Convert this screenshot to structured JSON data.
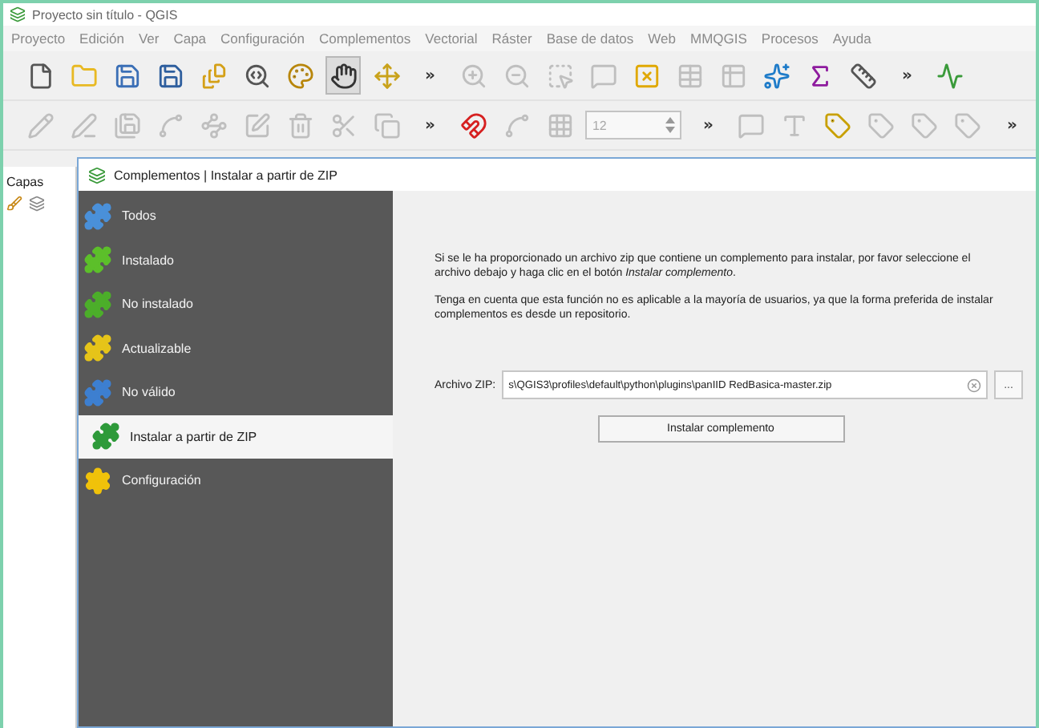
{
  "window": {
    "title": "Proyecto sin título - QGIS"
  },
  "menu": [
    "Proyecto",
    "Edición",
    "Ver",
    "Capa",
    "Configuración",
    "Complementos",
    "Vectorial",
    "Ráster",
    "Base de datos",
    "Web",
    "MMQGIS",
    "Procesos",
    "Ayuda"
  ],
  "toolbar_1": [
    {
      "kind": "icon",
      "disabled": false,
      "selected": false
    },
    {
      "kind": "icon",
      "disabled": false,
      "selected": false
    },
    {
      "kind": "icon",
      "disabled": false,
      "selected": false
    },
    {
      "kind": "icon",
      "disabled": false,
      "selected": false
    },
    {
      "kind": "icon",
      "disabled": false,
      "selected": false
    },
    {
      "kind": "icon",
      "disabled": false,
      "selected": false
    },
    {
      "kind": "icon",
      "disabled": false,
      "selected": false
    },
    {
      "kind": "icon",
      "disabled": false,
      "selected": true
    },
    {
      "kind": "icon",
      "disabled": false,
      "selected": false
    },
    {
      "kind": "overflow",
      "text": "»"
    },
    {
      "kind": "icon",
      "disabled": true,
      "selected": false
    },
    {
      "kind": "icon",
      "disabled": true,
      "selected": false
    },
    {
      "kind": "icon",
      "disabled": true,
      "selected": false
    },
    {
      "kind": "icon",
      "disabled": true,
      "selected": false
    },
    {
      "kind": "icon",
      "disabled": false,
      "selected": false
    },
    {
      "kind": "icon",
      "disabled": true,
      "selected": false
    },
    {
      "kind": "icon",
      "disabled": true,
      "selected": false
    },
    {
      "kind": "icon",
      "disabled": false,
      "selected": false
    },
    {
      "kind": "icon",
      "disabled": false,
      "selected": false
    },
    {
      "kind": "icon",
      "disabled": false,
      "selected": false
    },
    {
      "kind": "overflow",
      "text": "»"
    },
    {
      "kind": "icon",
      "disabled": false,
      "selected": false
    }
  ],
  "toolbar_2": [
    {
      "kind": "icon",
      "disabled": true,
      "selected": false
    },
    {
      "kind": "icon",
      "disabled": true,
      "selected": false
    },
    {
      "kind": "icon",
      "disabled": true,
      "selected": false
    },
    {
      "kind": "icon",
      "disabled": true,
      "selected": false
    },
    {
      "kind": "icon",
      "disabled": true,
      "selected": false
    },
    {
      "kind": "icon",
      "disabled": true,
      "selected": false
    },
    {
      "kind": "icon",
      "disabled": true,
      "selected": false
    },
    {
      "kind": "icon",
      "disabled": true,
      "selected": false
    },
    {
      "kind": "icon",
      "disabled": true,
      "selected": false
    },
    {
      "kind": "overflow",
      "text": "»"
    },
    {
      "kind": "icon",
      "disabled": false,
      "selected": false
    },
    {
      "kind": "icon",
      "disabled": true,
      "selected": false
    },
    {
      "kind": "icon",
      "disabled": true,
      "selected": false
    },
    {
      "kind": "spin",
      "value": "12"
    },
    {
      "kind": "overflow",
      "text": "»"
    },
    {
      "kind": "icon",
      "disabled": true,
      "selected": false
    },
    {
      "kind": "icon",
      "disabled": true,
      "selected": false
    },
    {
      "kind": "icon",
      "disabled": false,
      "selected": false
    },
    {
      "kind": "icon",
      "disabled": true,
      "selected": false
    },
    {
      "kind": "icon",
      "disabled": true,
      "selected": false
    },
    {
      "kind": "icon",
      "disabled": true,
      "selected": false
    },
    {
      "kind": "overflow",
      "text": "»"
    }
  ],
  "layers_panel": {
    "title": "Capas"
  },
  "dialog": {
    "title": "Complementos | Instalar a partir de ZIP",
    "sidebar": [
      {
        "label": "Todos",
        "selected": false
      },
      {
        "label": "Instalado",
        "selected": false
      },
      {
        "label": "No instalado",
        "selected": false
      },
      {
        "label": "Actualizable",
        "selected": false
      },
      {
        "label": "No válido",
        "selected": false
      },
      {
        "label": "Instalar a partir de ZIP",
        "selected": true
      },
      {
        "label": "Configuración",
        "selected": false
      }
    ],
    "paragraphs": [
      "Si se le ha proporcionado un archivo zip que contiene un complemento para instalar, por favor seleccione el archivo debajo y haga clic en el botón *Instalar complemento*.",
      "Tenga en cuenta que esta función no es aplicable a la mayoría de usuarios, ya que la forma preferida de instalar complementos es desde un repositorio."
    ],
    "zip_field": {
      "label": "Archivo ZIP:",
      "value": "s\\QGIS3\\profiles\\default\\python\\plugins\\panIID RedBasica-master.zip",
      "browse": "..."
    },
    "install_button": "Instalar complemento"
  }
}
